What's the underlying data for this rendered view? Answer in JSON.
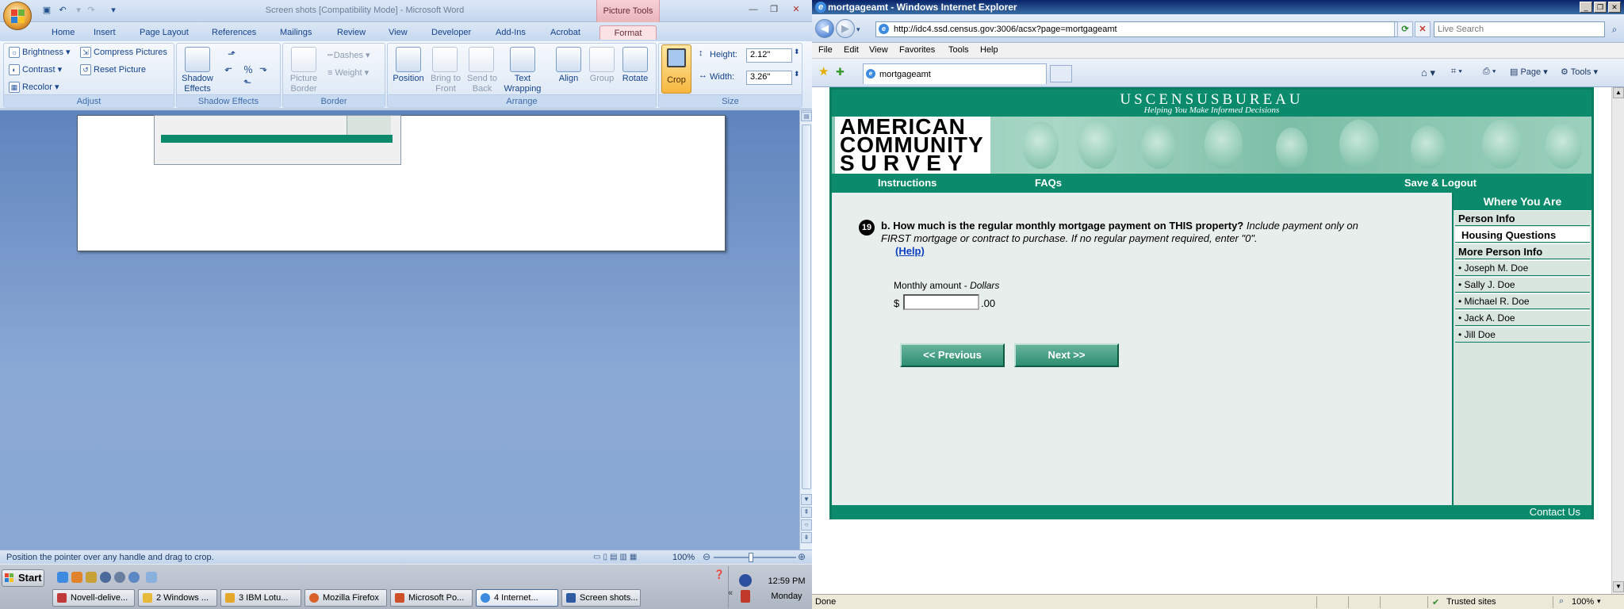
{
  "word": {
    "title": "Screen shots [Compatibility Mode] - Microsoft Word",
    "context_tab": "Picture Tools",
    "tabs": [
      "Home",
      "Insert",
      "Page Layout",
      "References",
      "Mailings",
      "Review",
      "View",
      "Developer",
      "Add-Ins",
      "Acrobat",
      "Format"
    ],
    "active_tab": "Format",
    "ribbon": {
      "adjust": {
        "label": "Adjust",
        "brightness": "Brightness",
        "contrast": "Contrast",
        "recolor": "Recolor",
        "compress": "Compress Pictures",
        "reset": "Reset Picture"
      },
      "shadow": {
        "label": "Shadow Effects",
        "button": "Shadow Effects"
      },
      "border": {
        "label": "Border",
        "picture_border": "Picture Border",
        "dashes": "Dashes",
        "weight": "Weight"
      },
      "arrange": {
        "label": "Arrange",
        "position": "Position",
        "bring_front": "Bring to Front",
        "send_back": "Send to Back",
        "text_wrap": "Text Wrapping",
        "align": "Align",
        "group": "Group",
        "rotate": "Rotate"
      },
      "size": {
        "label": "Size",
        "crop": "Crop",
        "height_label": "Height:",
        "height": "2.12\"",
        "width_label": "Width:",
        "width": "3.26\""
      }
    },
    "status": "Position the pointer over any handle and drag to crop.",
    "zoom": "100%"
  },
  "ie": {
    "title": "mortgageamt - Windows Internet Explorer",
    "url": "http://idc4.ssd.census.gov:3006/acsx?page=mortgageamt",
    "search_placeholder": "Live Search",
    "menu": [
      "File",
      "Edit",
      "View",
      "Favorites",
      "Tools",
      "Help"
    ],
    "tab_title": "mortgageamt",
    "commands": {
      "page": "Page",
      "tools": "Tools"
    },
    "status": "Done",
    "zone": "Trusted sites",
    "zoom": "100%"
  },
  "census": {
    "bureau": "USCENSUSBUREAU",
    "tagline": "Helping You Make Informed Decisions",
    "logo_lines": [
      "AMERICAN",
      "COMMUNITY",
      "SURVEY"
    ],
    "nav": {
      "instructions": "Instructions",
      "faqs": "FAQs",
      "save_logout": "Save & Logout"
    },
    "question": {
      "number": "19",
      "prefix": "b.",
      "text": "How much is the regular monthly mortgage payment on THIS property?",
      "instruction": "Include payment only on FIRST mortgage or contract to purchase. If no regular payment required, enter \"0\".",
      "help": "(Help)"
    },
    "amount_label": "Monthly amount",
    "amount_unit": "Dollars",
    "currency": "$",
    "amount_value": "",
    "cents": ".00",
    "prev_button": "<<   Previous",
    "next_button": "Next   >>",
    "sidebar": {
      "title": "Where You Are",
      "person_info": "Person Info",
      "housing": "Housing Questions",
      "more_person": "More Person Info",
      "people": [
        "• Joseph M. Doe",
        "• Sally J. Doe",
        "• Michael R. Doe",
        "• Jack A. Doe",
        "• Jill Doe"
      ]
    },
    "contact": "Contact Us"
  },
  "taskbar": {
    "start": "Start",
    "tasks": [
      "Novell-delive...",
      "2 Windows ...",
      "3 IBM Lotu...",
      "Mozilla Firefox",
      "Microsoft Po...",
      "4 Internet...",
      "Screen shots..."
    ],
    "active_task": "4 Internet...",
    "time": "12:59 PM",
    "day": "Monday"
  }
}
